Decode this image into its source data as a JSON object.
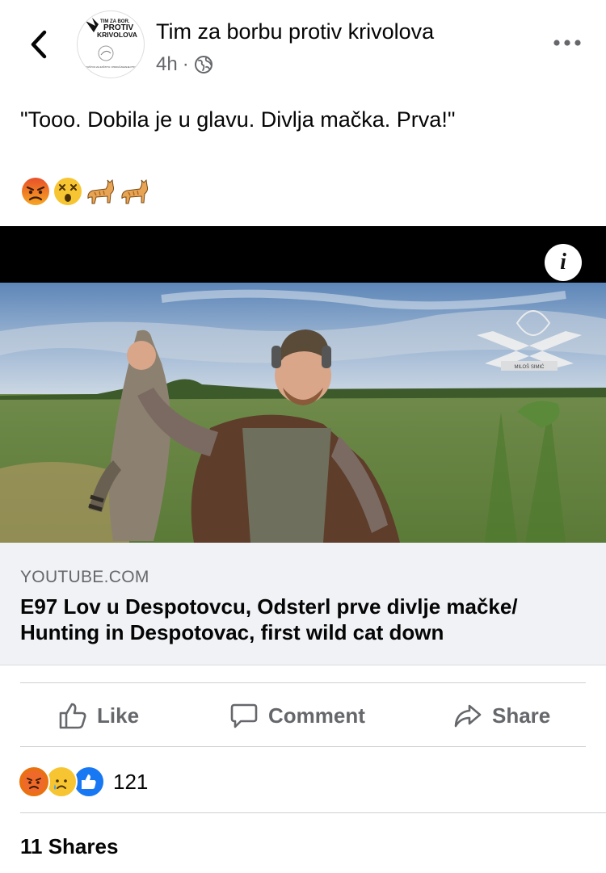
{
  "header": {
    "page_name": "Tim za borbu protiv krivolova",
    "time": "4h",
    "separator": "·",
    "avatar_logo": {
      "line1": "TIM ZA BOR.",
      "line2": "PROTIV",
      "line3": "KRIVOLOVA",
      "footer": "DRUŠTVO ZA ZAŠTITU I PROUČAVANJE PTICA"
    }
  },
  "post": {
    "text": "\"Tooo. Dobila je u glavu. Divlja mačka. Prva!\"",
    "emojis": [
      "😡",
      "😵",
      "🐈",
      "🐈"
    ]
  },
  "link_preview": {
    "domain": "YOUTUBE.COM",
    "title": "E97 Lov u Despotovcu, Odsterl prve divlje mačke/ Hunting in Despotovac, first wild cat down",
    "watermark_text": "MILOŠ SIMIĆ",
    "info_label": "i"
  },
  "actions": {
    "like": "Like",
    "comment": "Comment",
    "share": "Share"
  },
  "reactions": {
    "icons": [
      "angry",
      "sad",
      "like"
    ],
    "count": "121"
  },
  "shares": "11 Shares",
  "colors": {
    "secondary_text": "#65676b",
    "link_bg": "#f0f2f5",
    "like_blue": "#1877f2"
  }
}
